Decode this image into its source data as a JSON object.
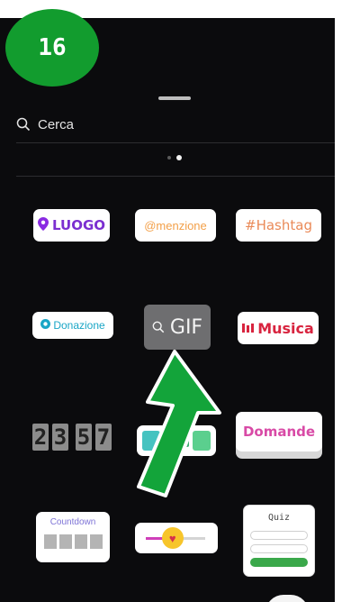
{
  "step_badge": {
    "label": "16",
    "color": "#129c2e"
  },
  "search": {
    "icon": "search-icon",
    "placeholder": "Cerca"
  },
  "pager": {
    "page_count": 2,
    "active_page": 2
  },
  "stickers": {
    "luogo": {
      "label": "LUOGO",
      "icon": "location-pin-icon"
    },
    "menzione": {
      "label": "@menzione"
    },
    "hashtag": {
      "label": "#Hashtag"
    },
    "donazione": {
      "label": "Donazione"
    },
    "gif": {
      "label": "GIF",
      "icon": "search-icon"
    },
    "musica": {
      "label": "Musica",
      "icon": "equalizer-icon"
    },
    "countdown_clock": {
      "digits": [
        "2",
        "3",
        "5",
        "7"
      ]
    },
    "domande": {
      "label": "Domande"
    },
    "countdown": {
      "label": "Countdown"
    },
    "slider": {
      "emoji": "heart-eyes-emoji",
      "level": 0.45
    },
    "quiz": {
      "label": "Quiz"
    }
  },
  "annotation": {
    "type": "green-arrow-pointing-up",
    "target": "gif",
    "color": "#13a43a"
  }
}
